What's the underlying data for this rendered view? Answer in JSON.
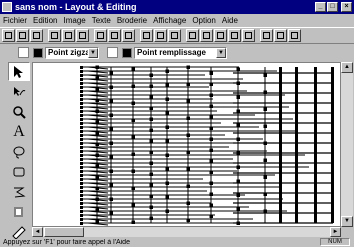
{
  "window": {
    "title": "sans nom - Layout & Editing",
    "minimize": "_",
    "maximize": "□",
    "close": "×"
  },
  "menu": [
    "Fichier",
    "Edition",
    "Image",
    "Texte",
    "Broderie",
    "Affichage",
    "Option",
    "Aide"
  ],
  "toolbar2": {
    "stitch_type": "Point zigzag",
    "fill_type": "Point remplissage"
  },
  "tools": [
    "select-arrow-icon",
    "reshape-icon",
    "zoom-icon",
    "text-icon",
    "lasso-icon",
    "rectangle-icon",
    "freehand-icon",
    "fill-icon",
    "ruler-icon"
  ],
  "status": {
    "message": "Appuyez sur 'F1' pour faire appel à l'Aide",
    "num": "NUM"
  },
  "scroll_arrows": {
    "up": "▲",
    "down": "▼",
    "left": "◄",
    "right": "►"
  }
}
